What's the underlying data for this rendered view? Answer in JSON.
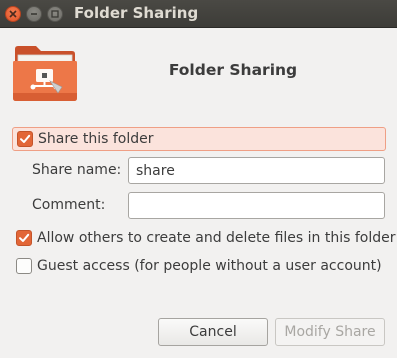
{
  "window": {
    "title": "Folder Sharing",
    "icons": [
      "close-icon",
      "minimize-icon",
      "maximize-icon"
    ]
  },
  "header": {
    "heading": "Folder Sharing",
    "icon": "shared-folder-icon"
  },
  "options": {
    "share_folder": {
      "label": "Share this folder",
      "checked": true
    },
    "allow_others": {
      "label": "Allow others to create and delete files in this folder",
      "checked": true
    },
    "guest_access": {
      "label": "Guest access (for people without a user account)",
      "checked": false
    }
  },
  "fields": {
    "share_name": {
      "label": "Share name:",
      "value": "share"
    },
    "comment": {
      "label": "Comment:",
      "value": ""
    }
  },
  "buttons": {
    "cancel": "Cancel",
    "modify": "Modify Share"
  },
  "colors": {
    "accent": "#e26637",
    "highlight_bg": "#fbe3dc",
    "titlebar": "#3d3c38"
  }
}
